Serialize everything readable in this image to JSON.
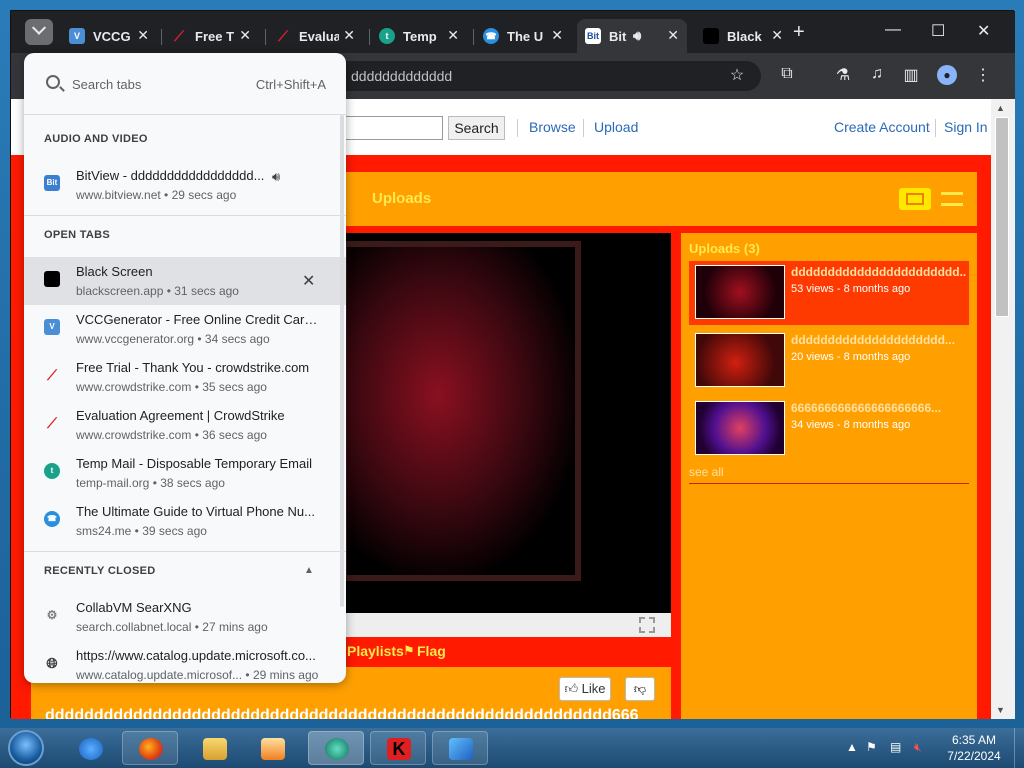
{
  "browser": {
    "tabs": [
      {
        "label": "VCCG",
        "icon": "vcc-icon",
        "color": "#4a8fd6"
      },
      {
        "label": "Free T",
        "icon": "crowdstrike-icon",
        "color": "#e0202a"
      },
      {
        "label": "Evalua",
        "icon": "crowdstrike-icon",
        "color": "#e0202a"
      },
      {
        "label": "Temp",
        "icon": "tempmail-icon",
        "color": "#1aa18a"
      },
      {
        "label": "The U",
        "icon": "sms24-icon",
        "color": "#2b8fe0"
      },
      {
        "label": "Bit",
        "icon": "bitview-icon",
        "color": "#3a7fd0"
      },
      {
        "label": "Black",
        "icon": "blackscreen-icon",
        "color": "#000000"
      }
    ],
    "new_tab": "+",
    "address": "ddddddddddddd",
    "window_controls": {
      "minimize": "—",
      "maximize": "☐",
      "close": "✕"
    }
  },
  "page": {
    "search_button": "Search",
    "nav": {
      "browse": "Browse",
      "upload": "Upload",
      "create_account": "Create Account",
      "sign_in": "Sign In"
    },
    "uploads_heading": "Uploads",
    "sidebar_heading": "Uploads (3)",
    "uploads": [
      {
        "title": "ddddddddddddddddddddddd...",
        "meta": "53 views - 8 months ago"
      },
      {
        "title": "ddddddddddddddddddddd...",
        "meta": "20 views - 8 months ago"
      },
      {
        "title": "666666666666666666666...",
        "meta": "34 views - 8 months ago"
      }
    ],
    "see_all": "see all",
    "playlists": "Playlists",
    "flag": "Flag",
    "like": "Like",
    "video_title": "dddddddddddddddddddddddddddddddddddddddddddddddddddddddddd666"
  },
  "tab_search": {
    "placeholder": "Search tabs",
    "shortcut": "Ctrl+Shift+A",
    "audio_section": "AUDIO AND VIDEO",
    "audio_items": [
      {
        "title": "BitView - ddddddddddddddddd...",
        "sub": "www.bitview.net • 29 secs ago",
        "icon": "bitview-icon",
        "color": "#3a7fd0",
        "glyph": "Bit"
      }
    ],
    "open_section": "OPEN TABS",
    "open_items": [
      {
        "title": "Black Screen",
        "sub": "blackscreen.app • 31 secs ago",
        "icon": "blackscreen-icon",
        "color": "#000000",
        "glyph": ""
      },
      {
        "title": "VCCGenerator - Free Online Credit Card ...",
        "sub": "www.vccgenerator.org • 34 secs ago",
        "icon": "vcc-icon",
        "color": "#4a8fd6",
        "glyph": "V"
      },
      {
        "title": "Free Trial - Thank You - crowdstrike.com",
        "sub": "www.crowdstrike.com • 35 secs ago",
        "icon": "crowdstrike-icon",
        "color": "#e0202a",
        "glyph": ""
      },
      {
        "title": "Evaluation Agreement | CrowdStrike",
        "sub": "www.crowdstrike.com • 36 secs ago",
        "icon": "crowdstrike-icon",
        "color": "#e0202a",
        "glyph": ""
      },
      {
        "title": "Temp Mail - Disposable Temporary Email",
        "sub": "temp-mail.org • 38 secs ago",
        "icon": "tempmail-icon",
        "color": "#1aa18a",
        "glyph": ""
      },
      {
        "title": "The Ultimate Guide to Virtual Phone Nu...",
        "sub": "sms24.me • 39 secs ago",
        "icon": "sms24-icon",
        "color": "#2b8fe0",
        "glyph": ""
      }
    ],
    "closed_section": "RECENTLY CLOSED",
    "closed_items": [
      {
        "title": "CollabVM SearXNG",
        "sub": "search.collabnet.local • 27 mins ago",
        "icon": "searxng-icon",
        "color": "#7a7f86",
        "glyph": ""
      },
      {
        "title": "https://www.catalog.update.microsoft.co...",
        "sub": "www.catalog.update.microsof... • 29 mins ago",
        "icon": "globe-icon",
        "color": "#3c4043",
        "glyph": ""
      }
    ]
  },
  "taskbar": {
    "clock_time": "6:35 AM",
    "clock_date": "7/22/2024"
  }
}
